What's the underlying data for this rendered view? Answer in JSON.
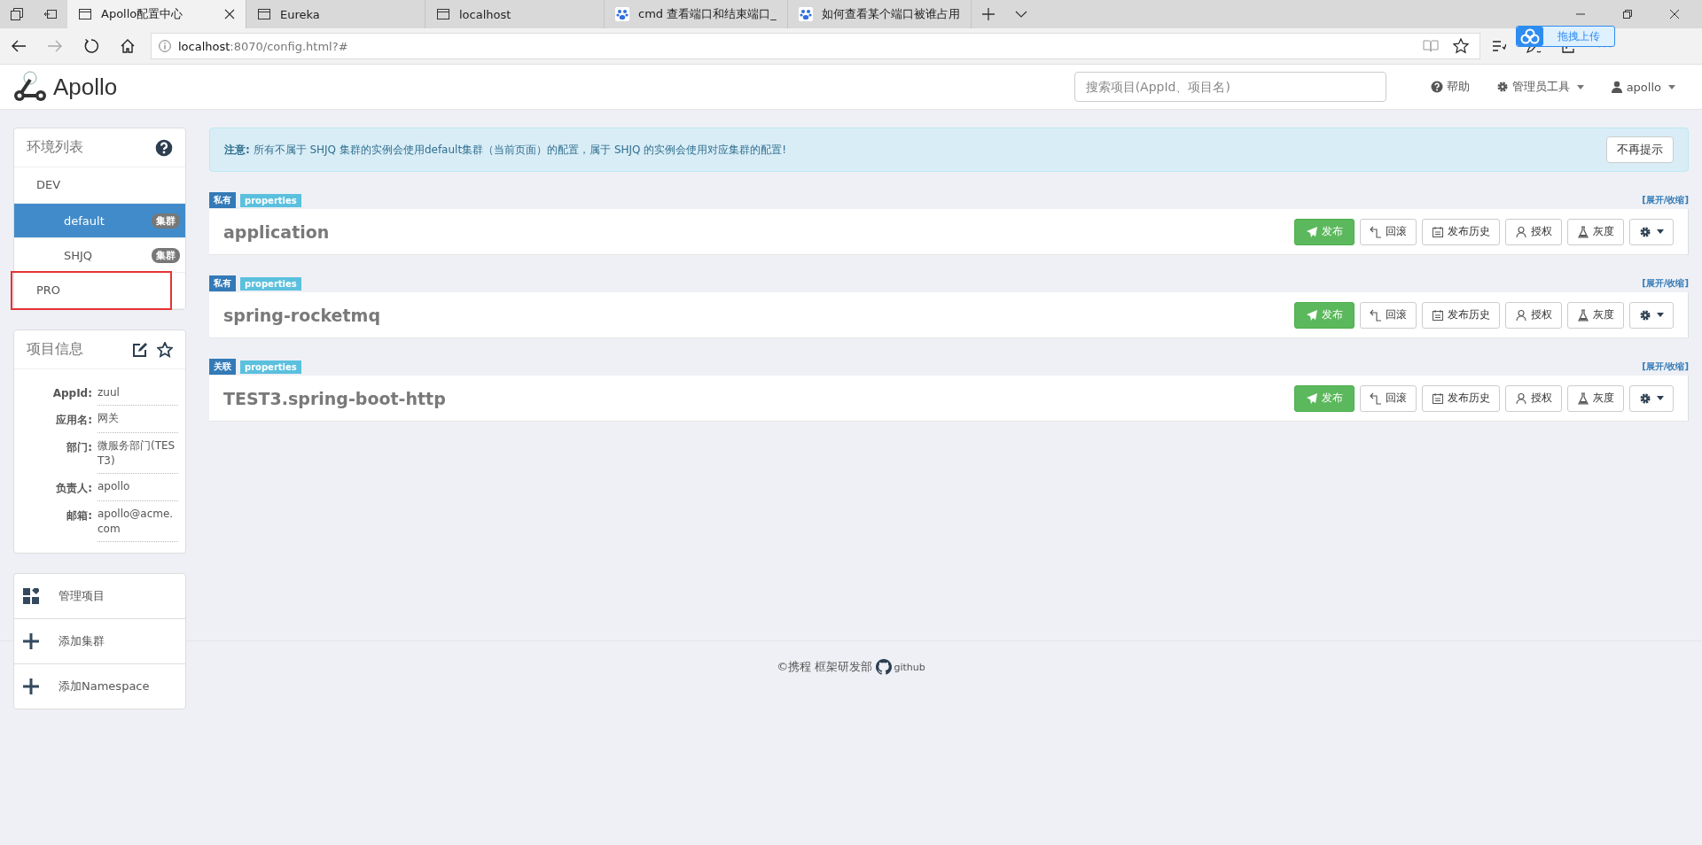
{
  "browser": {
    "tabs": [
      {
        "title": "Apollo配置中心",
        "selected": true
      },
      {
        "title": "Eureka",
        "selected": false
      },
      {
        "title": "localhost",
        "selected": false
      },
      {
        "title": "cmd 查看端口和结束端口_",
        "selected": false
      },
      {
        "title": "如何查看某个端口被谁占用",
        "selected": false
      }
    ],
    "url": {
      "host": "localhost",
      "path": ":8070/config.html?#"
    },
    "upload_badge": "拖拽上传"
  },
  "navbar": {
    "logo": "Apollo",
    "search": {
      "placeholder": "搜索项目(AppId、项目名)"
    },
    "links": [
      {
        "label": "帮助",
        "caret": false
      },
      {
        "label": "管理员工具",
        "caret": true
      },
      {
        "label": "apollo",
        "caret": true
      }
    ]
  },
  "env_panel": {
    "title": "环境列表",
    "envs": [
      {
        "name": "DEV",
        "highlighted": false,
        "children": [
          {
            "name": "default",
            "badge": "集群",
            "selected": true
          },
          {
            "name": "SHJQ",
            "badge": "集群",
            "selected": false
          }
        ]
      },
      {
        "name": "PRO",
        "highlighted": true
      }
    ]
  },
  "project_panel": {
    "title": "项目信息",
    "fields": [
      {
        "label": "AppId:",
        "value": "zuul"
      },
      {
        "label": "应用名:",
        "value": "网关"
      },
      {
        "label": "部门:",
        "value": "微服务部门(TEST3)"
      },
      {
        "label": "负责人:",
        "value": "apollo"
      },
      {
        "label": "邮箱:",
        "value": "apollo@acme.com"
      }
    ]
  },
  "actions": [
    {
      "label": "管理项目"
    },
    {
      "label": "添加集群"
    },
    {
      "label": "添加Namespace"
    }
  ],
  "notice": {
    "text": "**注意:** 所有不属于 SHJQ 集群的实例会使用default集群（当前页面）的配置，属于 SHJQ 的实例会使用对应集群的配置!",
    "button": "不再提示"
  },
  "namespaces": [
    {
      "scope": "私有",
      "format": "properties",
      "toggle": "[展开/收缩]",
      "name": "application",
      "buttons": [
        {
          "label": "发布",
          "kind": "primary"
        },
        {
          "label": "回滚",
          "kind": "rollback"
        },
        {
          "label": "发布历史",
          "kind": "history"
        },
        {
          "label": "授权",
          "kind": "auth"
        },
        {
          "label": "灰度",
          "kind": "gray"
        },
        {
          "kind": "settings"
        }
      ]
    },
    {
      "scope": "私有",
      "format": "properties",
      "toggle": "[展开/收缩]",
      "name": "spring-rocketmq",
      "buttons": [
        {
          "label": "发布",
          "kind": "primary"
        },
        {
          "label": "回滚",
          "kind": "rollback"
        },
        {
          "label": "发布历史",
          "kind": "history"
        },
        {
          "label": "授权",
          "kind": "auth"
        },
        {
          "label": "灰度",
          "kind": "gray"
        },
        {
          "kind": "settings"
        }
      ]
    },
    {
      "scope": "关联",
      "format": "properties",
      "toggle": "[展开/收缩]",
      "name": "TEST3.spring-boot-http",
      "buttons": [
        {
          "label": "发布",
          "kind": "primary"
        },
        {
          "label": "回滚",
          "kind": "rollback"
        },
        {
          "label": "发布历史",
          "kind": "history"
        },
        {
          "label": "授权",
          "kind": "auth"
        },
        {
          "label": "灰度",
          "kind": "gray"
        },
        {
          "kind": "settings"
        }
      ]
    }
  ],
  "footer": {
    "text": "©携程 框架研发部",
    "link": "github"
  }
}
